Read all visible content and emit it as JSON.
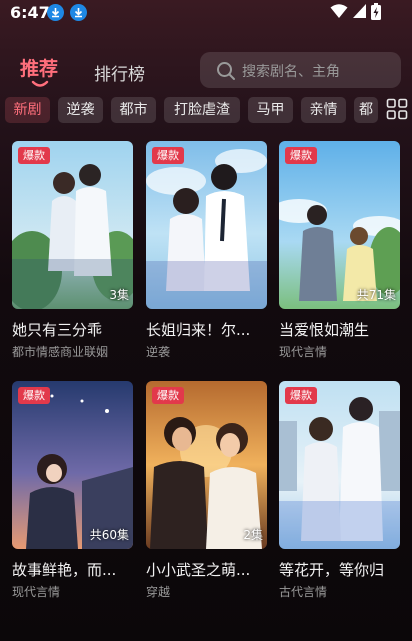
{
  "status": {
    "time": "6:47"
  },
  "tabs": [
    {
      "label": "推荐"
    },
    {
      "label": "排行榜"
    }
  ],
  "search": {
    "placeholder": "搜索剧名、主角"
  },
  "categories": [
    "新剧",
    "逆袭",
    "都市",
    "打脸虐渣",
    "马甲",
    "亲情",
    "都"
  ],
  "cards": [
    {
      "badge": "爆款",
      "title": "她只有三分乖",
      "tags": "都市情感商业联姻",
      "episodes": "3集"
    },
    {
      "badge": "爆款",
      "title": "长姐归来！尔...",
      "tags": "逆袭",
      "episodes": ""
    },
    {
      "badge": "爆款",
      "title": "当爱恨如潮生",
      "tags": "现代言情",
      "episodes": "共71集"
    },
    {
      "badge": "爆款",
      "title": "故事鲜艳，而...",
      "tags": "现代言情",
      "episodes": "共60集"
    },
    {
      "badge": "爆款",
      "title": "小小武圣之萌...",
      "tags": "穿越",
      "episodes": "2集"
    },
    {
      "badge": "爆款",
      "title": "等花开，等你归",
      "tags": "古代言情",
      "episodes": ""
    }
  ],
  "colors": {
    "accent": "#ff6f7c",
    "badge": "#e2394b"
  }
}
